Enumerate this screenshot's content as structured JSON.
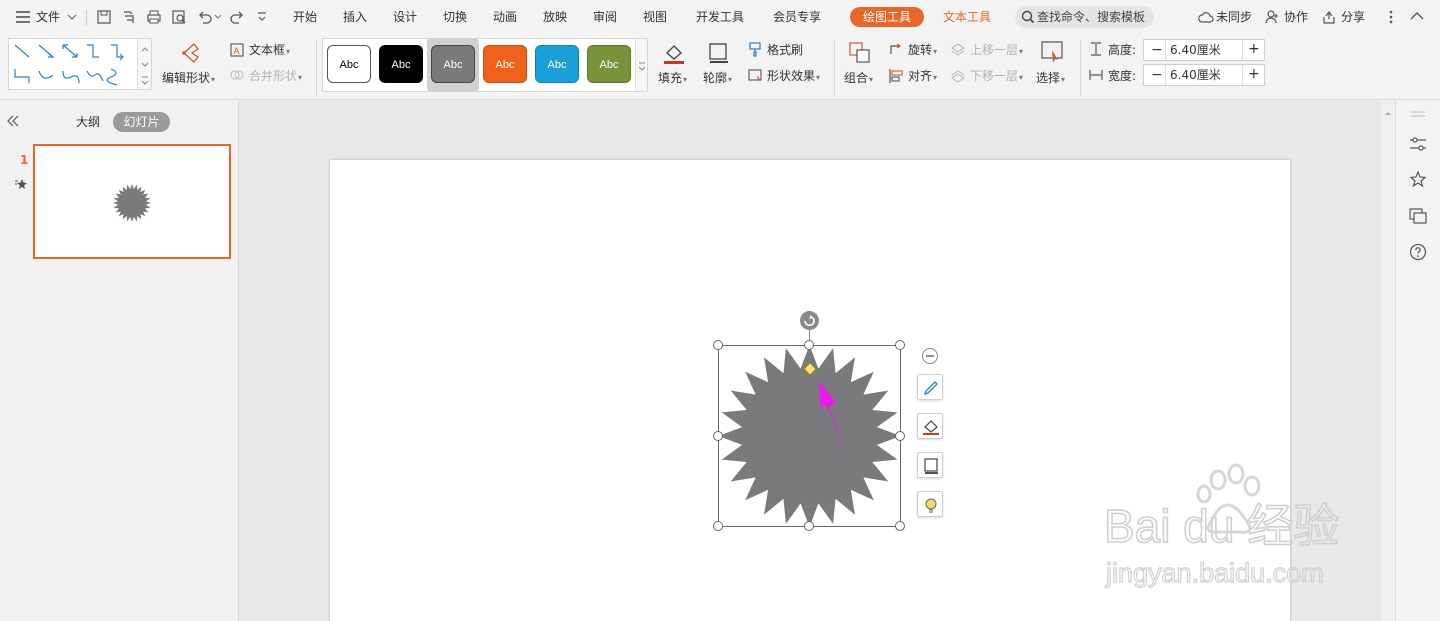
{
  "menubar": {
    "file_label": "文件",
    "tabs": [
      "开始",
      "插入",
      "设计",
      "切换",
      "动画",
      "放映",
      "审阅",
      "视图",
      "开发工具",
      "会员专享"
    ],
    "drawing_tools_tab": "绘图工具",
    "text_tools_tab": "文本工具",
    "search_placeholder": "查找命令、搜索模板",
    "sync_label": "未同步",
    "collab_label": "协作",
    "share_label": "分享"
  },
  "ribbon": {
    "edit_shape": "编辑形状",
    "textbox": "文本框",
    "merge_shape": "合并形状",
    "style_presets": [
      {
        "label": "Abc",
        "bg": "#ffffff",
        "fg": "#000000",
        "border": "#555555"
      },
      {
        "label": "Abc",
        "bg": "#000000",
        "fg": "#ffffff",
        "border": "#000000"
      },
      {
        "label": "Abc",
        "bg": "#7a7a7c",
        "fg": "#ffffff",
        "border": "#444444"
      },
      {
        "label": "Abc",
        "bg": "#f0621b",
        "fg": "#ffffff",
        "border": "#c44d12"
      },
      {
        "label": "Abc",
        "bg": "#1a9fd8",
        "fg": "#ffffff",
        "border": "#1180b0"
      },
      {
        "label": "Abc",
        "bg": "#78933c",
        "fg": "#ffffff",
        "border": "#5e7630"
      }
    ],
    "fill": "填充",
    "outline": "轮廓",
    "format_painter": "格式刷",
    "shape_effects": "形状效果",
    "group": "组合",
    "rotate": "旋转",
    "align": "对齐",
    "bring_forward": "上移一层",
    "send_backward": "下移一层",
    "select": "选择",
    "height_label": "高度:",
    "height_value": "6.40厘米",
    "width_label": "宽度:",
    "width_value": "6.40厘米"
  },
  "leftpane": {
    "outline_tab": "大纲",
    "slides_tab": "幻灯片",
    "slide_number": "1"
  },
  "colors": {
    "accent": "#e8662a",
    "shape_fill": "#7a7a7c",
    "arrow": "#e81ee8"
  },
  "watermark": {
    "brand": "Bai du 经验",
    "url": "jingyan.baidu.com"
  }
}
